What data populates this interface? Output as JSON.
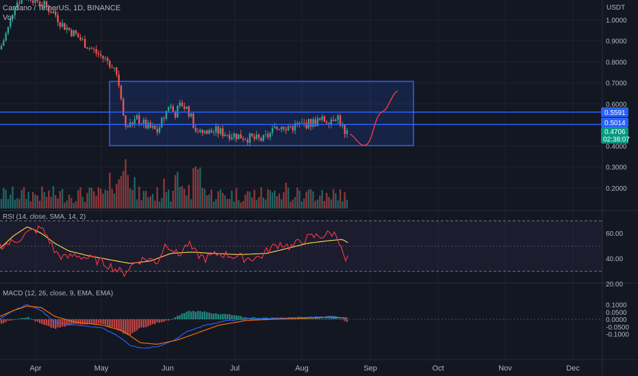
{
  "header": {
    "symbol": "Cardano / TetherUS, 1D, BINANCE",
    "vol_label": "Vol"
  },
  "price_axis": {
    "currency": "USDT",
    "ticks": [
      "1.0000",
      "0.9000",
      "0.8000",
      "0.7000",
      "0.6000",
      "0.5000",
      "0.4000",
      "0.3000",
      "0.2000"
    ]
  },
  "price_labels": {
    "level_high": "0.5591",
    "level_low": "0.5014",
    "last_price": "0.4706",
    "countdown": "02:38:07"
  },
  "rsi": {
    "label": "RSI (14, close, SMA, 14, 2)",
    "ticks": [
      "60.00",
      "40.00",
      "20.00"
    ]
  },
  "macd": {
    "label": "MACD (12, 26, close, 9, EMA, EMA)",
    "ticks": [
      "0.1000",
      "0.0500",
      "0.0000",
      "-0.0500",
      "-0.1000"
    ]
  },
  "time_axis": [
    "Apr",
    "May",
    "Jun",
    "Jul",
    "Aug",
    "Sep",
    "Oct",
    "Nov",
    "Dec"
  ],
  "colors": {
    "background": "#131722",
    "up": "#26a69a",
    "down": "#ef5350",
    "level_line": "#2962ff",
    "range_box": "#2962ff",
    "forecast": "#f23645",
    "rsi_line": "#f23645",
    "rsi_ma": "#f5d547",
    "macd_line": "#2962ff",
    "signal_line": "#ff6d00",
    "last_price_bg": "#089981"
  },
  "chart_data": {
    "type": "candlestick",
    "symbol": "Cardano / TetherUS",
    "timeframe": "1D",
    "exchange": "BINANCE",
    "price_range": [
      0.1,
      1.05
    ],
    "horizontal_levels": [
      0.5591,
      0.5014
    ],
    "range_box": {
      "from": "May",
      "to": "Aug",
      "top": 0.71,
      "bottom": 0.4
    },
    "last_price": 0.4706,
    "price_series": [
      {
        "month": "Mar",
        "close": 0.95
      },
      {
        "month": "Mar",
        "close": 1.1
      },
      {
        "month": "Apr",
        "close": 1.05
      },
      {
        "month": "Apr",
        "close": 0.97
      },
      {
        "month": "Apr",
        "close": 0.9
      },
      {
        "month": "Apr",
        "close": 0.84
      },
      {
        "month": "May",
        "close": 0.55
      },
      {
        "month": "May",
        "close": 0.5
      },
      {
        "month": "May",
        "close": 0.47
      },
      {
        "month": "Jun",
        "close": 0.52
      },
      {
        "month": "Jun",
        "close": 0.6
      },
      {
        "month": "Jun",
        "close": 0.47
      },
      {
        "month": "Jul",
        "close": 0.45
      },
      {
        "month": "Jul",
        "close": 0.44
      },
      {
        "month": "Jul",
        "close": 0.46
      },
      {
        "month": "Aug",
        "close": 0.5
      },
      {
        "month": "Aug",
        "close": 0.53
      },
      {
        "month": "Aug",
        "close": 0.55
      },
      {
        "month": "Aug",
        "close": 0.47
      }
    ],
    "forecast_path": [
      {
        "t": 0.0,
        "price": 0.47
      },
      {
        "t": 0.3,
        "price": 0.41
      },
      {
        "t": 0.5,
        "price": 0.5
      },
      {
        "t": 0.7,
        "price": 0.55
      },
      {
        "t": 1.0,
        "price": 0.65
      }
    ],
    "rsi_range": [
      20,
      70
    ],
    "macd_range": [
      -0.1,
      0.1
    ]
  }
}
